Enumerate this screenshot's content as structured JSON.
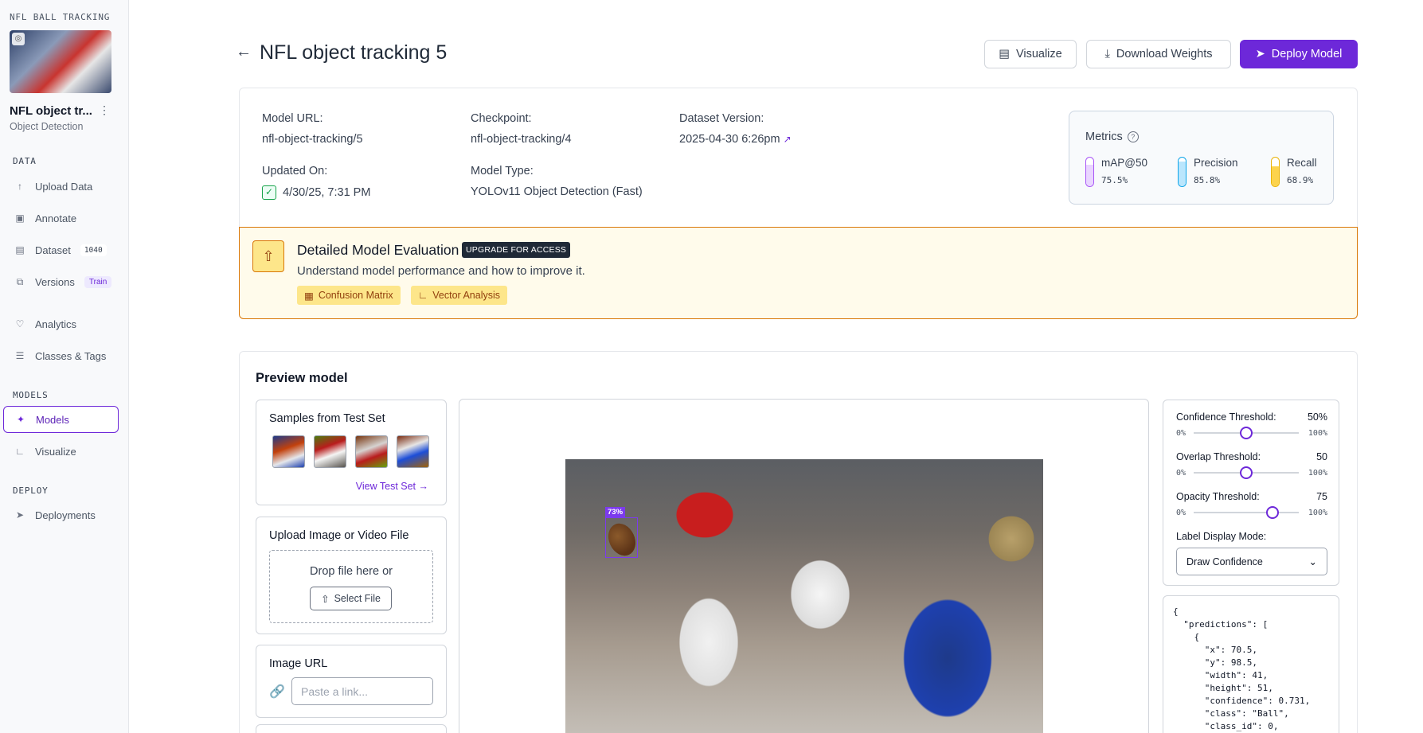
{
  "sidebar": {
    "project_label": "NFL BALL TRACKING",
    "project_name": "NFL object tr...",
    "project_type": "Object Detection",
    "sections": {
      "data": "DATA",
      "models": "MODELS",
      "deploy": "DEPLOY"
    },
    "items": [
      {
        "label": "Upload Data",
        "icon": "upload-icon"
      },
      {
        "label": "Annotate",
        "icon": "annotate-icon"
      },
      {
        "label": "Dataset",
        "icon": "dataset-icon",
        "badge": "1040"
      },
      {
        "label": "Versions",
        "icon": "versions-icon",
        "badge": "Train"
      },
      {
        "label": "Analytics",
        "icon": "analytics-icon"
      },
      {
        "label": "Classes & Tags",
        "icon": "list-icon"
      },
      {
        "label": "Models",
        "icon": "models-icon",
        "active": true
      },
      {
        "label": "Visualize",
        "icon": "chart-icon"
      },
      {
        "label": "Deployments",
        "icon": "rocket-icon"
      }
    ]
  },
  "header": {
    "title": "NFL object tracking 5",
    "visualize_label": "Visualize",
    "download_label": "Download Weights",
    "deploy_label": "Deploy Model"
  },
  "model_info": {
    "model_url_label": "Model URL:",
    "model_url": "nfl-object-tracking/5",
    "checkpoint_label": "Checkpoint:",
    "checkpoint": "nfl-object-tracking/4",
    "dataset_version_label": "Dataset Version:",
    "dataset_version": "2025-04-30 6:26pm",
    "updated_label": "Updated On:",
    "updated": "4/30/25, 7:31 PM",
    "model_type_label": "Model Type:",
    "model_type": "YOLOv11 Object Detection (Fast)"
  },
  "metrics": {
    "title": "Metrics",
    "items": [
      {
        "name": "mAP@50",
        "value": "75.5%",
        "fraction": 0.755,
        "color": "#a855f7",
        "fill": "#e9d5ff"
      },
      {
        "name": "Precision",
        "value": "85.8%",
        "fraction": 0.858,
        "color": "#0ea5e9",
        "fill": "#bae6fd"
      },
      {
        "name": "Recall",
        "value": "68.9%",
        "fraction": 0.689,
        "color": "#eab308",
        "fill": "#fcd34d"
      }
    ]
  },
  "upgrade": {
    "title": "Detailed Model Evaluation",
    "badge": "UPGRADE FOR ACCESS",
    "description": "Understand model performance and how to improve it.",
    "chip_confusion": "Confusion Matrix",
    "chip_vector": "Vector Analysis"
  },
  "preview": {
    "title": "Preview model",
    "samples_title": "Samples from Test Set",
    "view_test_set": "View Test Set →",
    "upload_title": "Upload Image or Video File",
    "drop_text": "Drop file here or",
    "select_file": "Select File",
    "url_title": "Image URL",
    "url_placeholder": "Paste a link...",
    "detection_label": "73%"
  },
  "settings": {
    "confidence": {
      "label": "Confidence Threshold:",
      "value": "50%",
      "min": "0%",
      "max": "100%",
      "level": 0.5
    },
    "overlap": {
      "label": "Overlap Threshold:",
      "value": "50",
      "min": "0%",
      "max": "100%",
      "level": 0.5
    },
    "opacity": {
      "label": "Opacity Threshold:",
      "value": "75",
      "min": "0%",
      "max": "100%",
      "level": 0.75
    },
    "label_mode_label": "Label Display Mode:",
    "label_mode_value": "Draw Confidence"
  },
  "json_output": "{\n  \"predictions\": [\n    {\n      \"x\": 70.5,\n      \"y\": 98.5,\n      \"width\": 41,\n      \"height\": 51,\n      \"confidence\": 0.731,\n      \"class\": \"Ball\",\n      \"class_id\": 0,"
}
